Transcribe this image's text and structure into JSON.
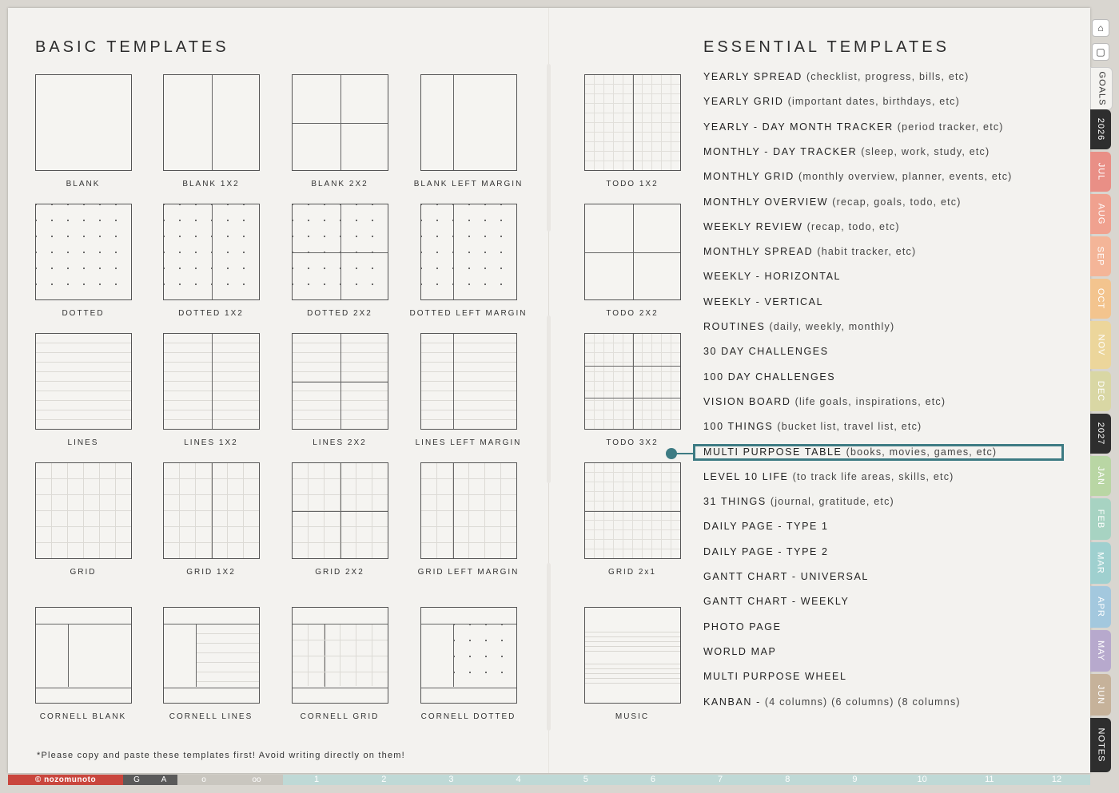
{
  "left": {
    "title": "BASIC TEMPLATES",
    "templates": [
      "BLANK",
      "BLANK 1X2",
      "BLANK 2X2",
      "BLANK LEFT MARGIN",
      "DOTTED",
      "DOTTED 1X2",
      "DOTTED 2X2",
      "DOTTED LEFT MARGIN",
      "LINES",
      "LINES 1X2",
      "LINES 2X2",
      "LINES LEFT MARGIN",
      "GRID",
      "GRID 1X2",
      "GRID 2X2",
      "GRID LEFT MARGIN",
      "CORNELL BLANK",
      "CORNELL LINES",
      "CORNELL GRID",
      "CORNELL DOTTED"
    ],
    "column5": [
      "TODO 1X2",
      "TODO 2X2",
      "TODO 3X2",
      "GRID 2x1",
      "MUSIC"
    ],
    "footnote": "*Please copy and paste these templates first! Avoid writing directly on them!"
  },
  "right": {
    "title": "ESSENTIAL TEMPLATES",
    "items": [
      {
        "name": "YEARLY SPREAD",
        "note": "(checklist, progress, bills, etc)"
      },
      {
        "name": "YEARLY GRID",
        "note": "(important dates, birthdays, etc)"
      },
      {
        "name": "YEARLY - DAY MONTH TRACKER",
        "note": "(period tracker, etc)"
      },
      {
        "name": "MONTHLY - DAY TRACKER",
        "note": "(sleep, work, study, etc)"
      },
      {
        "name": "MONTHLY GRID",
        "note": "(monthly overview, planner, events, etc)"
      },
      {
        "name": "MONTHLY OVERVIEW",
        "note": "(recap, goals, todo, etc)"
      },
      {
        "name": "WEEKLY REVIEW",
        "note": "(recap, todo, etc)"
      },
      {
        "name": "MONTHLY SPREAD",
        "note": "(habit tracker, etc)"
      },
      {
        "name": "WEEKLY - HORIZONTAL",
        "note": ""
      },
      {
        "name": "WEEKLY - VERTICAL",
        "note": ""
      },
      {
        "name": "ROUTINES",
        "note": "(daily, weekly, monthly)"
      },
      {
        "name": "30 DAY CHALLENGES",
        "note": ""
      },
      {
        "name": "100 DAY CHALLENGES",
        "note": ""
      },
      {
        "name": "VISION BOARD",
        "note": "(life goals, inspirations, etc)"
      },
      {
        "name": "100 THINGS",
        "note": "(bucket list, travel list, etc)"
      },
      {
        "name": "MULTI PURPOSE TABLE",
        "note": "(books, movies, games, etc)"
      },
      {
        "name": "LEVEL 10 LIFE",
        "note": "(to track life areas, skills, etc)"
      },
      {
        "name": "31 THINGS",
        "note": "(journal, gratitude, etc)"
      },
      {
        "name": "DAILY PAGE - TYPE 1",
        "note": ""
      },
      {
        "name": "DAILY PAGE - TYPE 2",
        "note": ""
      },
      {
        "name": "GANTT CHART - UNIVERSAL",
        "note": ""
      },
      {
        "name": "GANTT CHART - WEEKLY",
        "note": ""
      },
      {
        "name": "PHOTO PAGE",
        "note": ""
      },
      {
        "name": "WORLD MAP",
        "note": ""
      },
      {
        "name": "MULTI PURPOSE WHEEL",
        "note": ""
      },
      {
        "name": "KANBAN -",
        "note": "(4 columns) (6 columns) (8 columns)"
      }
    ],
    "highlight_color": "#3d7b83"
  },
  "bottom_bar": {
    "brand": "© nozomunoto",
    "segments": [
      "G",
      "A",
      "o",
      "oo"
    ],
    "months": [
      "1",
      "2",
      "3",
      "4",
      "5",
      "6",
      "7",
      "8",
      "9",
      "10",
      "11",
      "12"
    ]
  },
  "side_tabs": {
    "icons": [
      "home-icon",
      "square-icon"
    ],
    "tabs": [
      {
        "label": "GOALS",
        "color": "#f4f3f0"
      },
      {
        "label": "2026",
        "color": "#2e2e2e"
      },
      {
        "label": "JUL",
        "color": "#e98f86"
      },
      {
        "label": "AUG",
        "color": "#f0a18f"
      },
      {
        "label": "SEP",
        "color": "#f4b598"
      },
      {
        "label": "OCT",
        "color": "#f3c48e"
      },
      {
        "label": "NOV",
        "color": "#ecd69b"
      },
      {
        "label": "DEC",
        "color": "#d9d7a4"
      },
      {
        "label": "2027",
        "color": "#2e2e2e"
      },
      {
        "label": "JAN",
        "color": "#b9d6a4"
      },
      {
        "label": "FEB",
        "color": "#a7d3c2"
      },
      {
        "label": "MAR",
        "color": "#9fd0cf"
      },
      {
        "label": "APR",
        "color": "#a3c8de"
      },
      {
        "label": "MAY",
        "color": "#b7a9cd"
      },
      {
        "label": "JUN",
        "color": "#c6b29a"
      },
      {
        "label": "NOTES",
        "color": "#2e2e2e"
      }
    ]
  }
}
